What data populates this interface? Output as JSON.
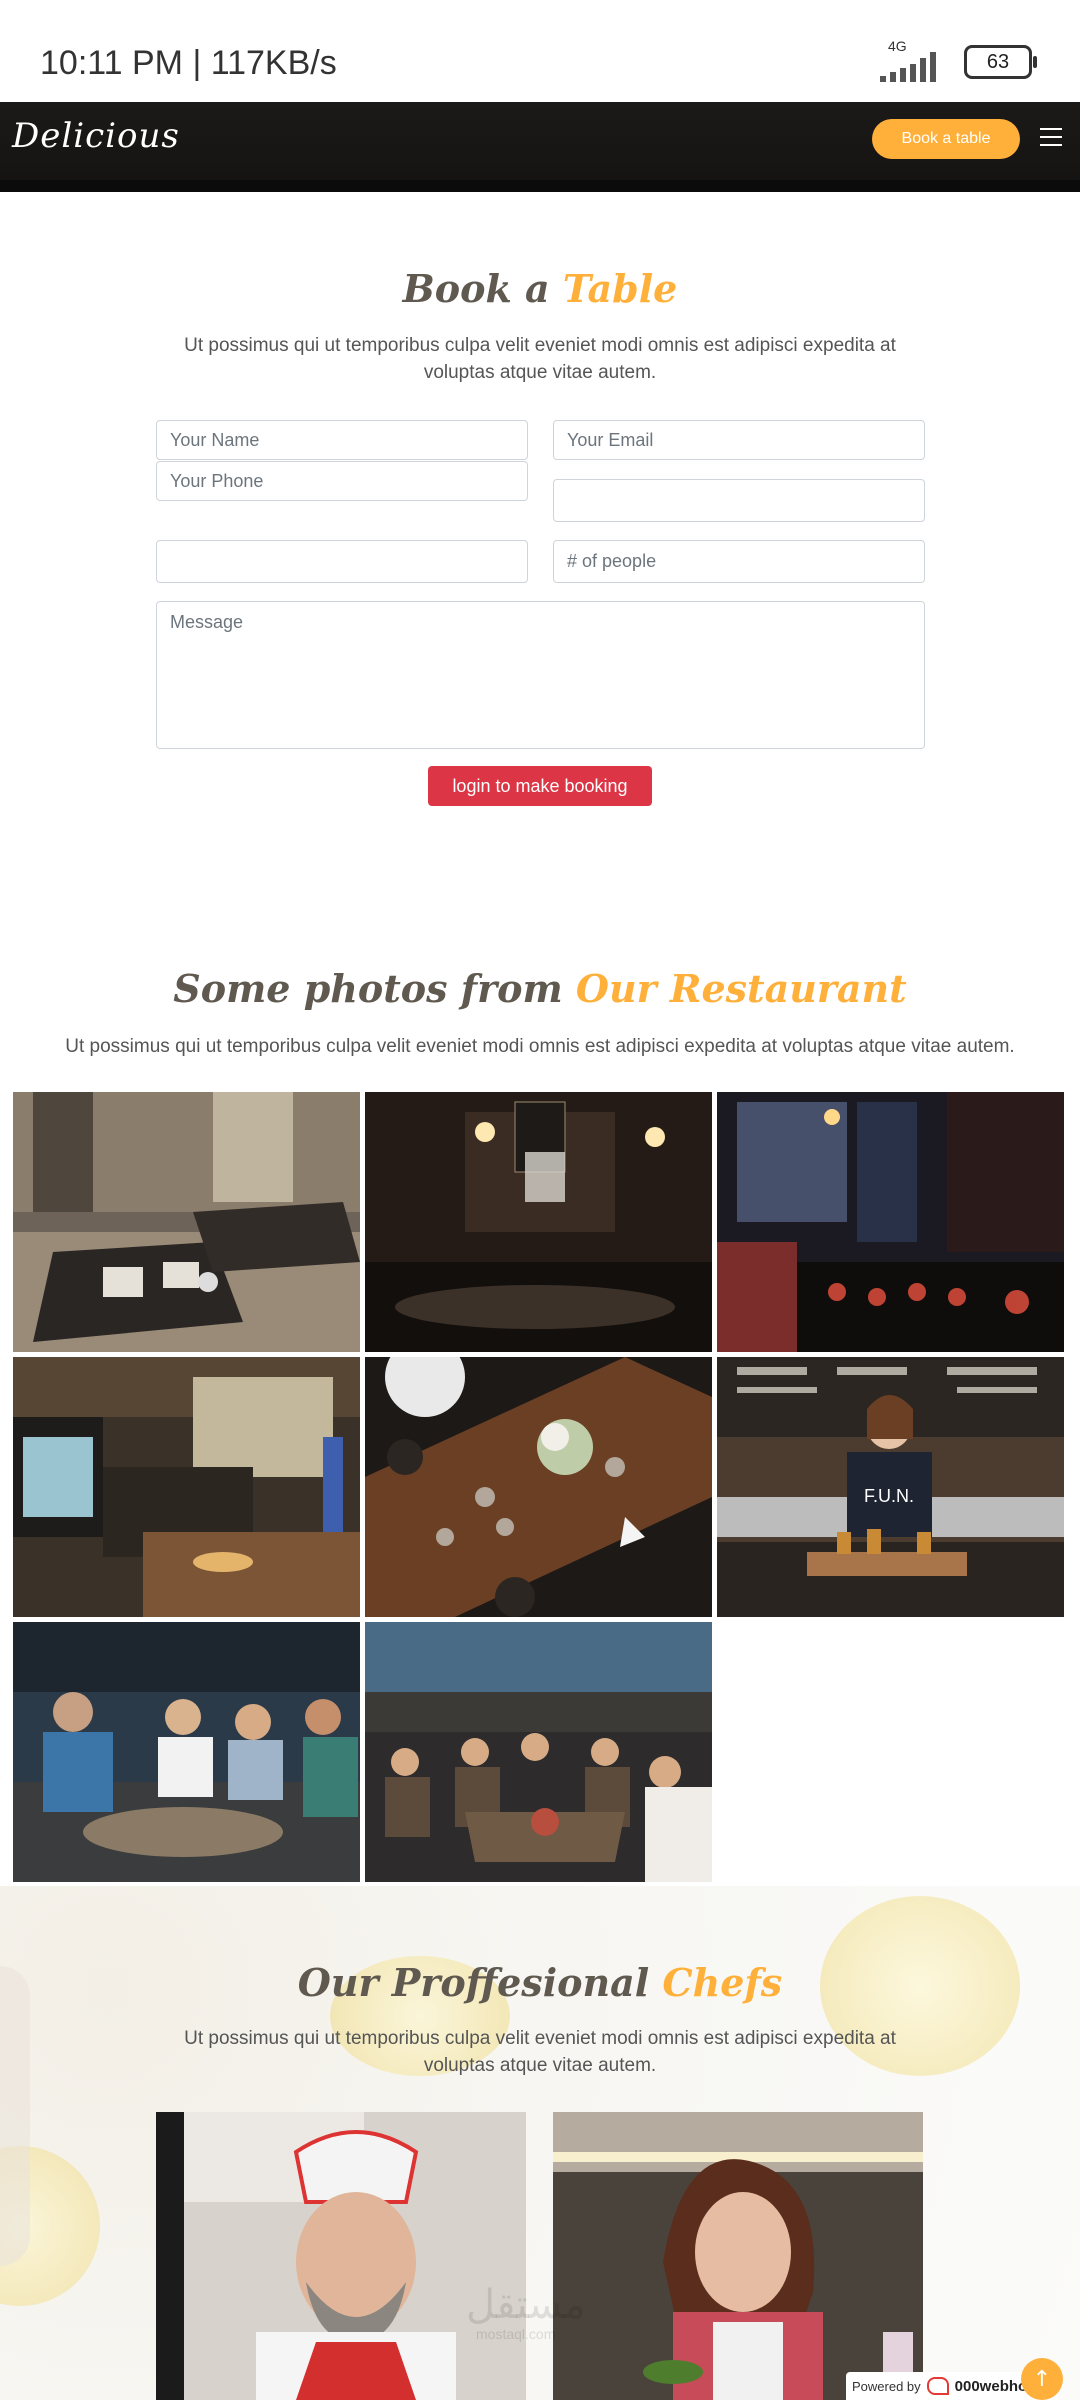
{
  "status": {
    "time": "10:11 PM | 117KB/s",
    "network": "4G",
    "battery": "63"
  },
  "header": {
    "logo": "Delicious",
    "book_button": "Book a table"
  },
  "booking": {
    "title_a": "Book a ",
    "title_b": "Table",
    "subtitle": "Ut possimus qui ut temporibus culpa velit eveniet modi omnis est adipisci expedita at voluptas atque vitae autem.",
    "name_placeholder": "Your Name",
    "email_placeholder": "Your Email",
    "phone_placeholder": "Your Phone",
    "people_placeholder": "# of people",
    "message_placeholder": "Message",
    "submit": "login to make booking"
  },
  "gallery": {
    "title_a": "Some photos from ",
    "title_b": "Our Restaurant",
    "subtitle": "Ut possimus qui ut temporibus culpa velit eveniet modi omnis est adipisci expedita at voluptas atque vitae autem.",
    "photo_fun": "F.U.N."
  },
  "chefs": {
    "title_a": "Our Proffesional ",
    "title_b": "Chefs",
    "subtitle": "Ut possimus qui ut temporibus culpa velit eveniet modi omnis est adipisci expedita at voluptas atque vitae autem."
  },
  "overlay": {
    "watermark": "مستقل",
    "watermark_sub": "mostaql.com",
    "powered_by": "Powered by",
    "host": "000webhost"
  },
  "colors": {
    "accent": "#ffb03b",
    "danger": "#dc3545",
    "header": "#171615"
  },
  "icons": [
    "signal-icon",
    "battery-icon",
    "menu-icon",
    "arrow-up-icon",
    "webhost-logo-icon"
  ]
}
